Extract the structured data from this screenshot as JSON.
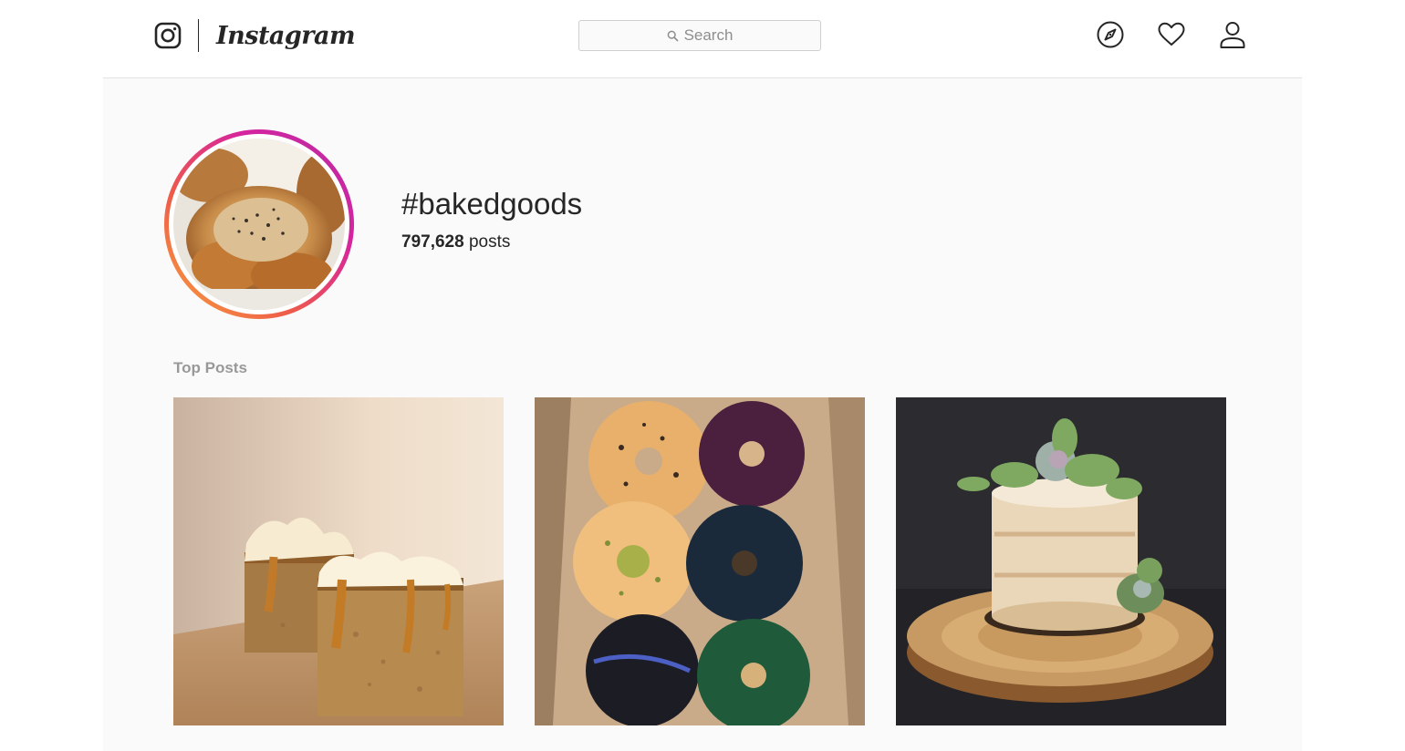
{
  "header": {
    "logo_wordmark": "Instagram",
    "search": {
      "placeholder": "Search",
      "icon": "search-icon"
    },
    "nav_icons": [
      "compass-icon",
      "heart-icon",
      "user-icon"
    ]
  },
  "hashtag": {
    "title": "#bakedgoods",
    "post_count": "797,628",
    "post_count_suffix": "posts"
  },
  "sections": {
    "top_posts_label": "Top Posts"
  },
  "top_posts": [
    {
      "subject": "carrot cake slices with cream cheese frosting and caramel"
    },
    {
      "subject": "box of glazed doughnuts"
    },
    {
      "subject": "naked cake with succulents on wooden slab"
    }
  ],
  "colors": {
    "story_ring_start": "#f9a43a",
    "story_ring_end": "#b52ea6",
    "background": "#fafafa",
    "text": "#262626",
    "muted": "#999999"
  }
}
